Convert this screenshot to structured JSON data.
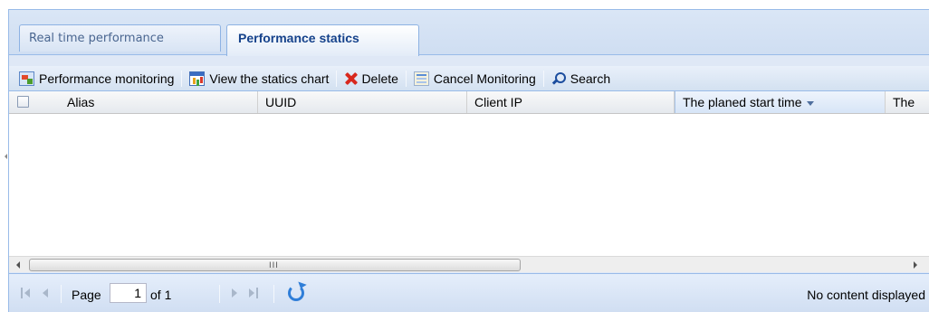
{
  "tabs": [
    {
      "label": "Real time performance",
      "active": false
    },
    {
      "label": "Performance statics",
      "active": true
    }
  ],
  "toolbar": {
    "performance_monitoring": "Performance monitoring",
    "view_statics_chart": "View the statics chart",
    "delete": "Delete",
    "cancel_monitoring": "Cancel Monitoring",
    "search": "Search"
  },
  "grid": {
    "columns": [
      "Alias",
      "UUID",
      "Client IP",
      "The planed start time",
      "The"
    ],
    "sorted_column": "The planed start time",
    "sort_direction": "descending",
    "rows": []
  },
  "scrollbar": {
    "grip": "III"
  },
  "pager": {
    "page_label": "Page",
    "current_page": "1",
    "of_label": "of 1",
    "status": "No content displayed"
  },
  "colors": {
    "panel_background": "#dfe8f6",
    "border": "#99bbe8",
    "active_tab_text": "#15428b",
    "delete_icon": "#d8281d"
  }
}
